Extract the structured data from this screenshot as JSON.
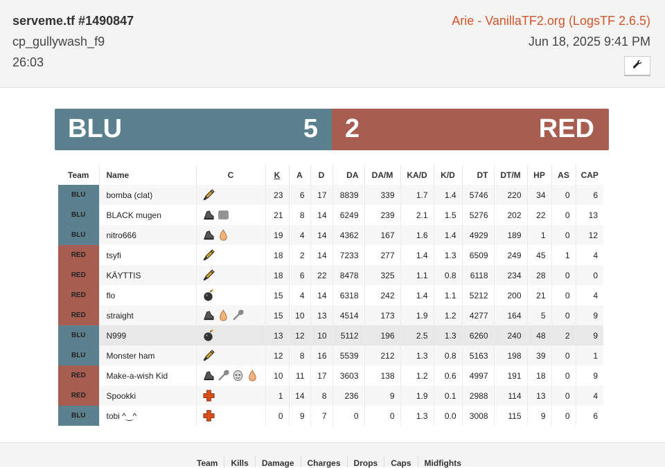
{
  "header": {
    "title": "serveme.tf #1490847",
    "map": "cp_gullywash_f9",
    "duration": "26:03",
    "source": "Arie - VanillaTF2.org (LogsTF 2.6.5)",
    "date": "Jun 18, 2025 9:41 PM",
    "wrench_icon": "wrench-icon"
  },
  "score": {
    "blu_name": "BLU",
    "blu_score": "5",
    "red_score": "2",
    "red_name": "RED",
    "blu_color": "#5b818f",
    "red_color": "#a75d50"
  },
  "table": {
    "headers": [
      "Team",
      "Name",
      "C",
      "K",
      "A",
      "D",
      "DA",
      "DA/M",
      "KA/D",
      "K/D",
      "DT",
      "DT/M",
      "HP",
      "AS",
      "CAP"
    ],
    "rows": [
      {
        "team": "BLU",
        "name": "bomba (clat)",
        "classes": [
          "medic"
        ],
        "k": "23",
        "a": "6",
        "d": "17",
        "da": "8839",
        "dam": "339",
        "kad": "1.7",
        "kd": "1.4",
        "dt": "5746",
        "dtm": "220",
        "hp": "34",
        "as": "0",
        "cap": "6"
      },
      {
        "team": "BLU",
        "name": "BLACK mugen",
        "classes": [
          "scout",
          "heavy"
        ],
        "k": "21",
        "a": "8",
        "d": "14",
        "da": "6249",
        "dam": "239",
        "kad": "2.1",
        "kd": "1.5",
        "dt": "5276",
        "dtm": "202",
        "hp": "22",
        "as": "0",
        "cap": "13"
      },
      {
        "team": "BLU",
        "name": "nitro666",
        "classes": [
          "scout",
          "pyro"
        ],
        "k": "19",
        "a": "4",
        "d": "14",
        "da": "4362",
        "dam": "167",
        "kad": "1.6",
        "kd": "1.4",
        "dt": "4929",
        "dtm": "189",
        "hp": "1",
        "as": "0",
        "cap": "12"
      },
      {
        "team": "RED",
        "name": "tsyfi",
        "classes": [
          "medic"
        ],
        "k": "18",
        "a": "2",
        "d": "14",
        "da": "7233",
        "dam": "277",
        "kad": "1.4",
        "kd": "1.3",
        "dt": "6509",
        "dtm": "249",
        "hp": "45",
        "as": "1",
        "cap": "4"
      },
      {
        "team": "RED",
        "name": "KÄYTTIS",
        "classes": [
          "medic"
        ],
        "k": "18",
        "a": "6",
        "d": "22",
        "da": "8478",
        "dam": "325",
        "kad": "1.1",
        "kd": "0.8",
        "dt": "6118",
        "dtm": "234",
        "hp": "28",
        "as": "0",
        "cap": "0"
      },
      {
        "team": "RED",
        "name": "flo",
        "classes": [
          "demoman"
        ],
        "k": "15",
        "a": "4",
        "d": "14",
        "da": "6318",
        "dam": "242",
        "kad": "1.4",
        "kd": "1.1",
        "dt": "5212",
        "dtm": "200",
        "hp": "21",
        "as": "0",
        "cap": "4"
      },
      {
        "team": "RED",
        "name": "straight",
        "classes": [
          "scout",
          "pyro",
          "engineer"
        ],
        "k": "15",
        "a": "10",
        "d": "13",
        "da": "4514",
        "dam": "173",
        "kad": "1.9",
        "kd": "1.2",
        "dt": "4277",
        "dtm": "164",
        "hp": "5",
        "as": "0",
        "cap": "9"
      },
      {
        "team": "BLU",
        "name": "N999",
        "classes": [
          "demoman"
        ],
        "k": "13",
        "a": "12",
        "d": "10",
        "da": "5112",
        "dam": "196",
        "kad": "2.5",
        "kd": "1.3",
        "dt": "6260",
        "dtm": "240",
        "hp": "48",
        "as": "2",
        "cap": "9"
      },
      {
        "team": "BLU",
        "name": "Monster ham",
        "classes": [
          "medic"
        ],
        "k": "12",
        "a": "8",
        "d": "16",
        "da": "5539",
        "dam": "212",
        "kad": "1.3",
        "kd": "0.8",
        "dt": "5163",
        "dtm": "198",
        "hp": "39",
        "as": "0",
        "cap": "1"
      },
      {
        "team": "RED",
        "name": "Make-a-wish Kid",
        "classes": [
          "scout",
          "engineer",
          "spy",
          "pyro"
        ],
        "k": "10",
        "a": "11",
        "d": "17",
        "da": "3603",
        "dam": "138",
        "kad": "1.2",
        "kd": "0.6",
        "dt": "4997",
        "dtm": "191",
        "hp": "18",
        "as": "0",
        "cap": "9"
      },
      {
        "team": "RED",
        "name": "Spookki",
        "classes": [
          "medic-cross"
        ],
        "k": "1",
        "a": "14",
        "d": "8",
        "da": "236",
        "dam": "9",
        "kad": "1.9",
        "kd": "0.1",
        "dt": "2988",
        "dtm": "114",
        "hp": "13",
        "as": "0",
        "cap": "4"
      },
      {
        "team": "BLU",
        "name": "tobi ^‿^",
        "classes": [
          "medic-cross"
        ],
        "k": "0",
        "a": "9",
        "d": "7",
        "da": "0",
        "dam": "0",
        "kad": "1.3",
        "kd": "0.0",
        "dt": "3008",
        "dtm": "115",
        "hp": "9",
        "as": "0",
        "cap": "6"
      }
    ]
  },
  "tabs": [
    "Team",
    "Kills",
    "Damage",
    "Charges",
    "Drops",
    "Caps",
    "Midfights"
  ]
}
